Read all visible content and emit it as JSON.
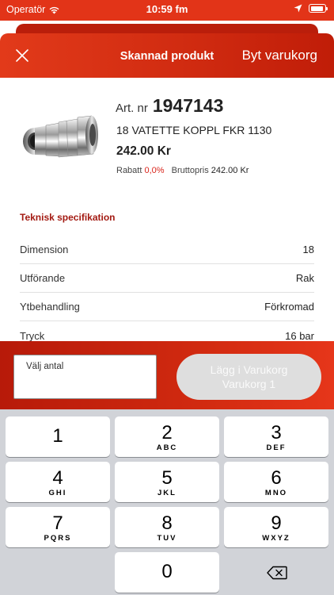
{
  "status_bar": {
    "carrier": "Operatör",
    "time": "10:59 fm",
    "battery_level": 0.92
  },
  "nav": {
    "title": "Skannad produkt",
    "right_action": "Byt varukorg",
    "close_icon": "close-icon"
  },
  "product": {
    "art_label": "Art. nr",
    "art_number": "1947143",
    "name": "18 VATETTE KOPPL FKR 1130",
    "price": "242.00 Kr",
    "discount_label": "Rabatt",
    "discount_value": "0,0%",
    "gross_label": "Bruttopris",
    "gross_value": "242.00 Kr"
  },
  "spec": {
    "title": "Teknisk specifikation",
    "rows": [
      {
        "label": "Dimension",
        "value": "18"
      },
      {
        "label": "Utförande",
        "value": "Rak"
      },
      {
        "label": "Ytbehandling",
        "value": "Förkromad"
      },
      {
        "label": "Tryck",
        "value": "16 bar"
      }
    ]
  },
  "action": {
    "qty_label": "Välj antal",
    "qty_value": "",
    "add_button_line1": "Lägg i Varukorg",
    "add_button_line2": "Varukorg 1"
  },
  "keypad": {
    "keys": [
      {
        "num": "1",
        "letters": ""
      },
      {
        "num": "2",
        "letters": "ABC"
      },
      {
        "num": "3",
        "letters": "DEF"
      },
      {
        "num": "4",
        "letters": "GHI"
      },
      {
        "num": "5",
        "letters": "JKL"
      },
      {
        "num": "6",
        "letters": "MNO"
      },
      {
        "num": "7",
        "letters": "PQRS"
      },
      {
        "num": "8",
        "letters": "TUV"
      },
      {
        "num": "9",
        "letters": "WXYZ"
      },
      {
        "num": "0",
        "letters": ""
      }
    ],
    "delete_icon": "backspace-icon"
  },
  "colors": {
    "brand_red": "#d12a10",
    "discount_red": "#d9251c",
    "spec_title": "#a31a12",
    "disabled_button": "#dedede"
  }
}
